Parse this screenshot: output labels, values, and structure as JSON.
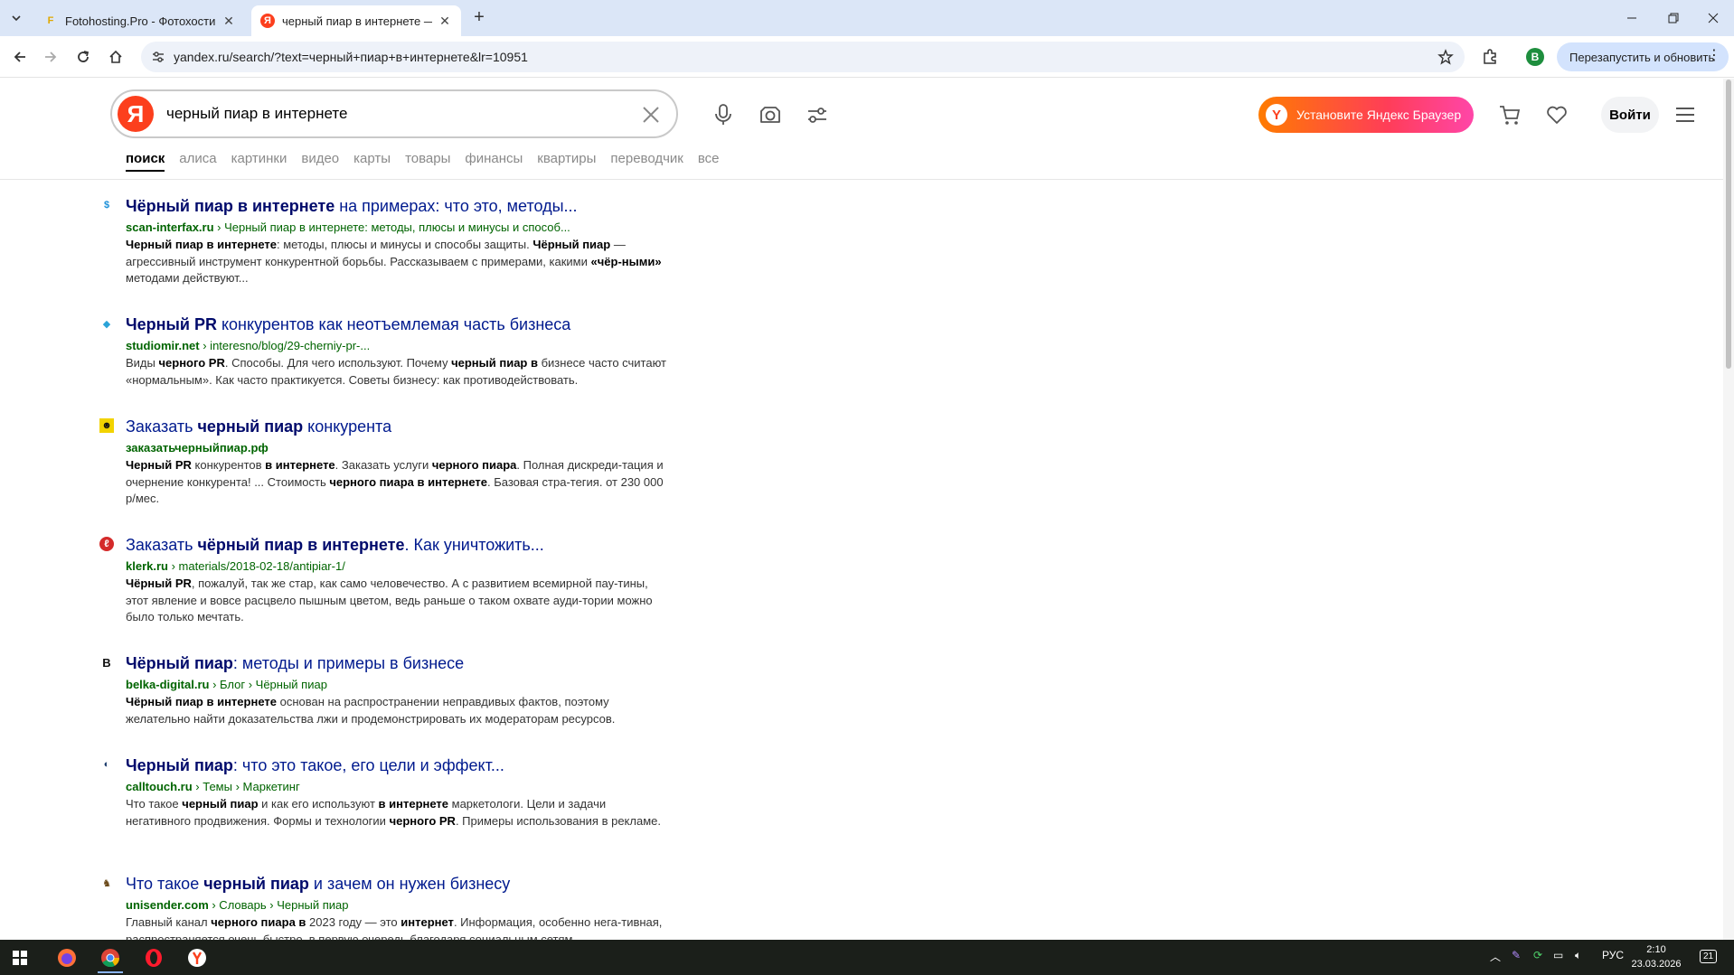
{
  "browser": {
    "tabs": [
      {
        "title": "Fotohosting.Pro - Фотохостинг",
        "favicon": "F",
        "active": false
      },
      {
        "title": "черный пиар в интернете — Я",
        "favicon": "Я",
        "active": true
      }
    ],
    "url": "yandex.ru/search/?text=черный+пиар+в+интернете&lr=10951",
    "profile_initial": "B",
    "relaunch_label": "Перезапустить и обновить"
  },
  "yandex": {
    "logo": "Я",
    "query": "черный пиар в интернете",
    "promo_label": "Установите Яндекс Браузер",
    "promo_icon": "Y",
    "login_label": "Войти",
    "tabs": [
      "поиск",
      "алиса",
      "картинки",
      "видео",
      "карты",
      "товары",
      "финансы",
      "квартиры",
      "переводчик",
      "все"
    ]
  },
  "results": [
    {
      "favicon": "$",
      "title_html": "<b>Чёрный пиар в интернете</b> на примерах: что это, методы...",
      "url_html": "<b>scan-interfax.ru</b> › Черный пиар в интернете: методы, плюсы и минусы и способ...",
      "snippet_html": "<b>Черный пиар в интернете</b>: методы, плюсы и минусы и способы защиты. <b>Чёрный пиар</b> — агрессивный инструмент конкурентной борьбы. Рассказываем с примерами, какими <b>«чёр-ными»</b> методами действуют..."
    },
    {
      "favicon": "◆",
      "title_html": "<b>Черный PR</b> конкурентов как неотъемлемая часть бизнеса",
      "url_html": "<b>studiomir.net</b> › interesno/blog/29-cherniy-pr-...",
      "snippet_html": "Виды <b>черного PR</b>. Способы. Для чего используют. Почему <b>черный пиар в</b> бизнесе часто считают «нормальным». Как часто практикуется. Советы бизнесу: как противодействовать."
    },
    {
      "favicon": "☻",
      "title_html": "Заказать <b>черный пиар</b> конкурента",
      "url_html": "<b>заказатьчерныйпиар.рф</b>",
      "snippet_html": "<b>Черный PR</b> конкурентов <b>в интернете</b>. Заказать услуги <b>черного пиара</b>. Полная дискреди-тация и очернение конкурента! ... Стоимость <b>черного пиара в интернете</b>. Базовая стра-тегия. от 230 000 р/мес."
    },
    {
      "favicon": "ℓ",
      "title_html": "Заказать <b>чёрный пиар в интернете</b>. Как уничтожить...",
      "url_html": "<b>klerk.ru</b> › materials/2018-02-18/antipiar-1/",
      "snippet_html": "<b>Чёрный PR</b>, пожалуй, так же стар, как само человечество. А с развитием всемирной пау-тины, этот явление и вовсе расцвело пышным цветом, ведь раньше о таком охвате ауди-тории можно было только мечтать."
    },
    {
      "favicon": "B",
      "title_html": "<b>Чёрный пиар</b>: методы и примеры в бизнесе",
      "url_html": "<b>belka-digital.ru</b> › Блог › Чёрный пиар",
      "snippet_html": "<b>Чёрный пиар в интернете</b> основан на распространении неправдивых фактов, поэтому желательно найти доказательства лжи и продемонстрировать их модераторам ресурсов."
    },
    {
      "favicon": "◐",
      "title_html": "<b>Черный пиар</b>: что это такое, его цели и эффект...",
      "url_html": "<b>calltouch.ru</b> › Темы › Маркетинг",
      "snippet_html": "Что такое <b>черный пиар</b> и как его используют <b>в интернете</b> маркетологи. Цели и задачи негативного продвижения. Формы и технологии <b>черного PR</b>. Примеры использования в рекламе."
    },
    {
      "favicon": "♞",
      "title_html": "Что такое <b>черный пиар</b> и зачем он нужен бизнесу",
      "url_html": "<b>unisender.com</b> › Словарь › Черный пиар",
      "snippet_html": "Главный канал <b>черного пиара в</b> 2023 году — это <b>интернет</b>. Информация, особенно нега-тивная, распространяется очень быстро, в первую очередь благодаря социальным сетям."
    }
  ],
  "taskbar": {
    "language": "РУС",
    "time": "2:10",
    "date": "23.03.2026",
    "notifications": "21"
  }
}
